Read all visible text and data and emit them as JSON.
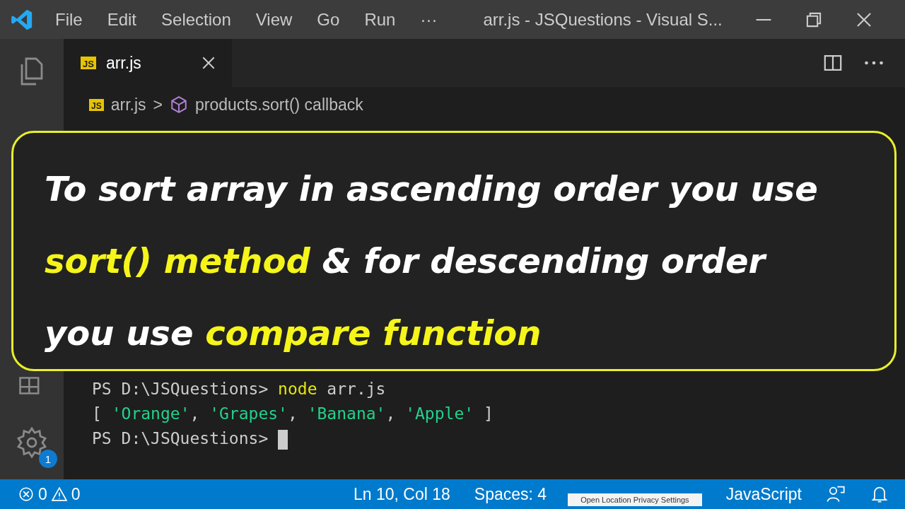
{
  "title_bar": {
    "menu": [
      "File",
      "Edit",
      "Selection",
      "View",
      "Go",
      "Run",
      "···"
    ],
    "title": "arr.js - JSQuestions - Visual S..."
  },
  "tabs": [
    {
      "label": "arr.js",
      "icon": "JS",
      "selected": true
    }
  ],
  "breadcrumb": {
    "file_icon": "JS",
    "file": "arr.js",
    "separator": ">",
    "symbol": "products.sort() callback"
  },
  "activity_bar": {
    "badge": "1"
  },
  "caption": {
    "lines": [
      [
        {
          "text": "To sort array in ascending order you use",
          "highlight": false
        }
      ],
      [
        {
          "text": "sort() method",
          "highlight": true
        },
        {
          "text": " & for descending order",
          "highlight": false
        }
      ],
      [
        {
          "text": "you use ",
          "highlight": false
        },
        {
          "text": "compare function",
          "highlight": true
        }
      ]
    ]
  },
  "terminal": {
    "lines": [
      [
        {
          "text": "PS D:\\JSQuestions> ",
          "kind": "plain"
        },
        {
          "text": "node",
          "kind": "command"
        },
        {
          "text": " arr.js",
          "kind": "plain"
        }
      ],
      [
        {
          "text": "[ ",
          "kind": "plain"
        },
        {
          "text": "'Orange'",
          "kind": "string"
        },
        {
          "text": ", ",
          "kind": "plain"
        },
        {
          "text": "'Grapes'",
          "kind": "string"
        },
        {
          "text": ", ",
          "kind": "plain"
        },
        {
          "text": "'Banana'",
          "kind": "string"
        },
        {
          "text": ", ",
          "kind": "plain"
        },
        {
          "text": "'Apple'",
          "kind": "string"
        },
        {
          "text": " ]",
          "kind": "plain"
        }
      ],
      [
        {
          "text": "PS D:\\JSQuestions> ",
          "kind": "plain"
        },
        {
          "kind": "cursor"
        }
      ]
    ]
  },
  "status_bar": {
    "errors": "0",
    "warnings": "0",
    "position": "Ln 10, Col 18",
    "spaces": "Spaces: 4",
    "language": "JavaScript",
    "tooltip": "Open Location Privacy Settings"
  }
}
